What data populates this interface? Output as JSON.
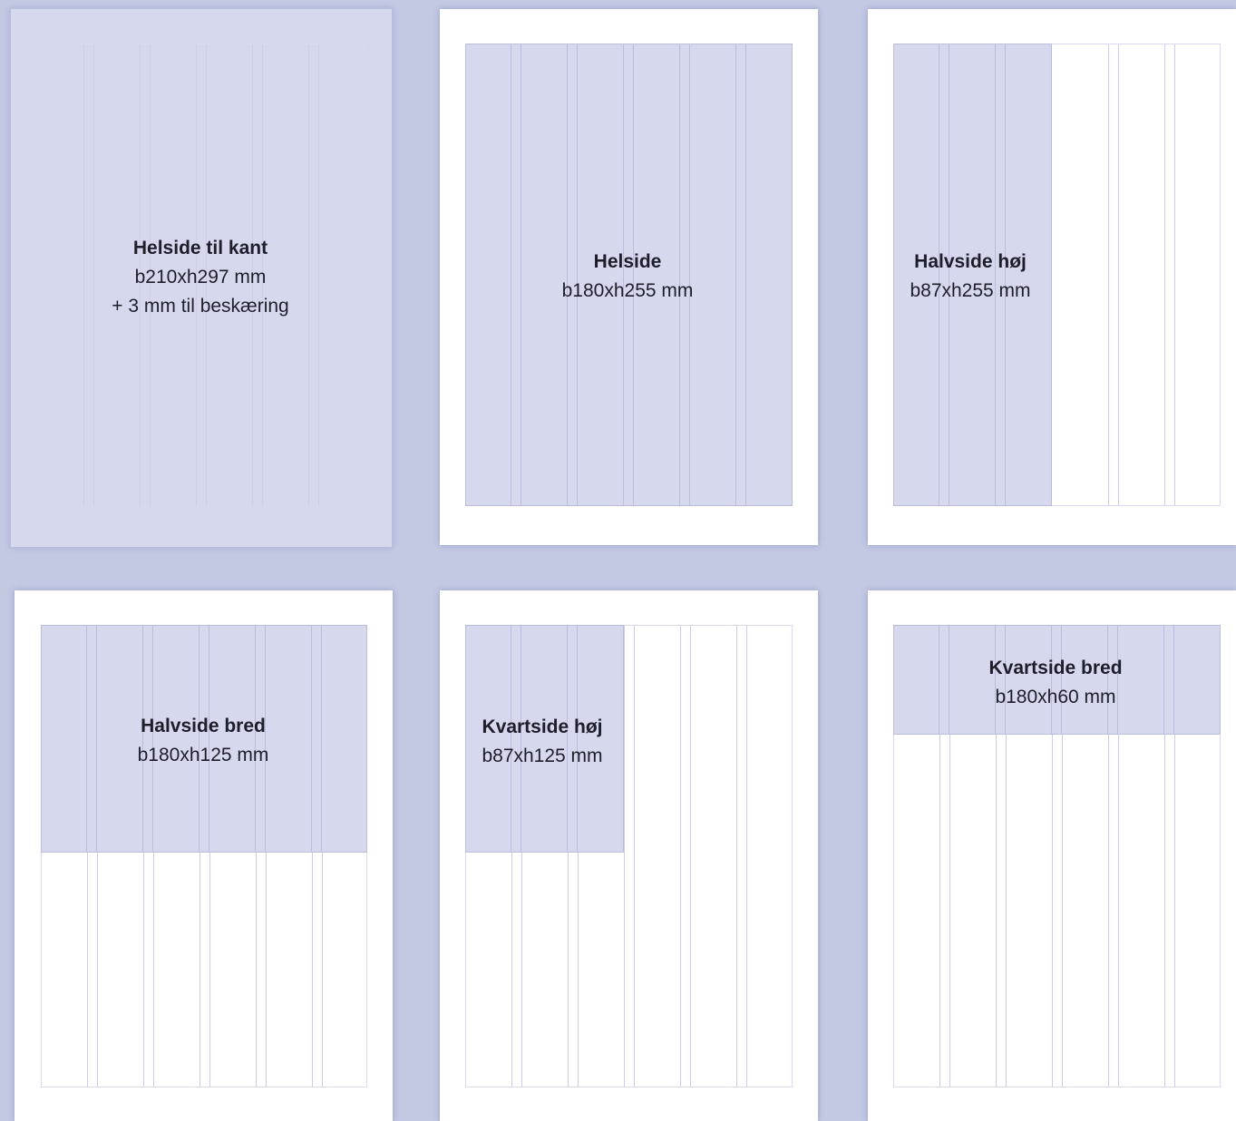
{
  "background_color": "#c3c8e3",
  "ad_color": "#d6d9ee",
  "ad_sizes": [
    {
      "title": "Helside til kant",
      "dimensions": "b210xh297 mm",
      "note": "+ 3 mm til beskæring"
    },
    {
      "title": "Helside",
      "dimensions": "b180xh255 mm"
    },
    {
      "title": "Halvside høj",
      "dimensions": "b87xh255 mm"
    },
    {
      "title": "Halvside bred",
      "dimensions": "b180xh125 mm"
    },
    {
      "title": "Kvartside høj",
      "dimensions": "b87xh125 mm"
    },
    {
      "title": "Kvartside bred",
      "dimensions": "b180xh60 mm"
    }
  ]
}
